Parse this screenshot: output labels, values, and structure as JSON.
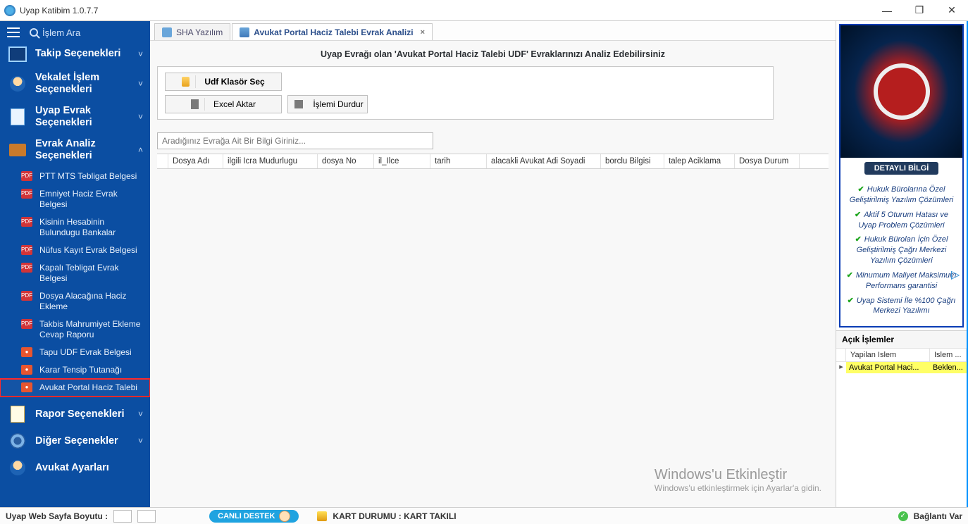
{
  "window": {
    "title": "Uyap Katibim 1.0.7.7",
    "minimize": "—",
    "maximize": "❐",
    "close": "✕"
  },
  "sidebar": {
    "search_placeholder": "İşlem Ara",
    "sections": [
      {
        "label": "Takip Seçenekleri",
        "chev": "˅"
      },
      {
        "label": "Vekalet İşlem Seçenekleri",
        "chev": "˅"
      },
      {
        "label": "Uyap Evrak Seçenekleri",
        "chev": "˅"
      },
      {
        "label": "Evrak Analiz Seçenekleri",
        "chev": "˄"
      },
      {
        "label": "Rapor Seçenekleri",
        "chev": "˅"
      },
      {
        "label": "Diğer Seçenekler",
        "chev": "˅"
      },
      {
        "label": "Avukat Ayarları",
        "chev": ""
      }
    ],
    "analiz_items": [
      {
        "label": "PTT MTS Tebligat Belgesi",
        "color": "red"
      },
      {
        "label": "Emniyet Haciz Evrak Belgesi",
        "color": "red"
      },
      {
        "label": "Kisinin Hesabinin Bulundugu Bankalar",
        "color": "red"
      },
      {
        "label": "Nüfus Kayıt Evrak Belgesi",
        "color": "red"
      },
      {
        "label": "Kapalı Tebligat Evrak Belgesi",
        "color": "red"
      },
      {
        "label": "Dosya Alacağına Haciz Ekleme",
        "color": "red"
      },
      {
        "label": "Takbis Mahrumiyet Ekleme Cevap Raporu",
        "color": "red"
      },
      {
        "label": "Tapu UDF Evrak Belgesi",
        "color": "orange"
      },
      {
        "label": "Karar Tensip Tutanağı",
        "color": "orange"
      },
      {
        "label": "Avukat Portal Haciz Talebi",
        "color": "orange"
      }
    ]
  },
  "tabs": [
    {
      "label": "SHA Yazılım",
      "active": false
    },
    {
      "label": "Avukat Portal Haciz Talebi Evrak Analizi",
      "active": true
    }
  ],
  "page": {
    "title": "Uyap Evrağı olan 'Avukat Portal Haciz Talebi UDF' Evraklarınızı Analiz Edebilirsiniz",
    "btn_udf": "Udf Klasör Seç",
    "btn_excel": "Excel Aktar",
    "btn_stop": "İşlemi Durdur",
    "search_placeholder": "Aradığınız Evrağa Ait Bir Bilgi Giriniz...",
    "grid_headers": [
      "Dosya Adı",
      "ilgili Icra Mudurlugu",
      "dosya No",
      "il_Ilce",
      "tarih",
      "alacakli Avukat Adi Soyadi",
      "borclu Bilgisi",
      "talep Aciklama",
      "Dosya Durum"
    ]
  },
  "ad": {
    "button": "DETAYLI BİLGİ",
    "items": [
      "Hukuk Bürolarına Özel Geliştirilmiş Yazılım Çözümleri",
      "Aktif 5 Oturum Hatası ve Uyap Problem Çözümleri",
      "Hukuk Büroları İçin Özel Geliştirilmiş Çağrı Merkezi Yazılım Çözümleri",
      "Minumum Maliyet Maksimum Performans garantisi",
      "Uyap Sistemi İle %100 Çağrı Merkezi Yazılımı"
    ]
  },
  "ops": {
    "title": "Açık İşlemler",
    "h1": " ",
    "h2": "Yapilan Islem",
    "h3": "Islem ...",
    "row": {
      "c2": "Avukat Portal Haci...",
      "c3": "Beklen..."
    },
    "arrow": "▸"
  },
  "watermark": {
    "l1": "Windows'u Etkinleştir",
    "l2": "Windows'u etkinleştirmek için Ayarlar'a gidin."
  },
  "status": {
    "label": "Uyap Web Sayfa Boyutu :",
    "live": "CANLI DESTEK",
    "kart_label": "KART DURUMU :",
    "kart_value": "KART TAKILI",
    "conn": "Bağlantı Var"
  },
  "expand_arrow": "▷"
}
